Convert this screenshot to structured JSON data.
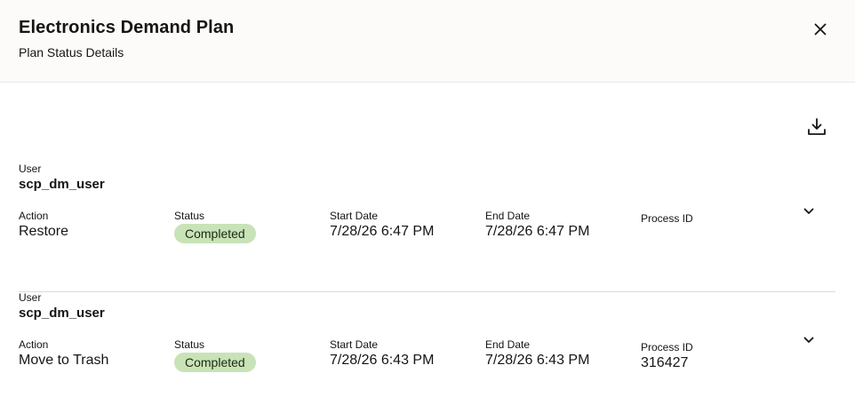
{
  "header": {
    "title": "Electronics Demand Plan",
    "subtitle": "Plan Status Details"
  },
  "icons": {
    "close": "close-icon",
    "download": "download-icon",
    "expand": "chevron-down-icon"
  },
  "colors": {
    "completed_badge_bg": "#c8e3b7",
    "divider": "#dedbd7"
  },
  "labels": {
    "user": "User",
    "action": "Action",
    "status": "Status",
    "start_date": "Start Date",
    "end_date": "End Date",
    "process_id": "Process ID"
  },
  "records": [
    {
      "user": "scp_dm_user",
      "action": "Restore",
      "status": "Completed",
      "start_date": "7/28/26 6:47 PM",
      "end_date": "7/28/26 6:47 PM",
      "process_id": ""
    },
    {
      "user": "scp_dm_user",
      "action": "Move to Trash",
      "status": "Completed",
      "start_date": "7/28/26 6:43 PM",
      "end_date": "7/28/26 6:43 PM",
      "process_id": "316427"
    }
  ]
}
